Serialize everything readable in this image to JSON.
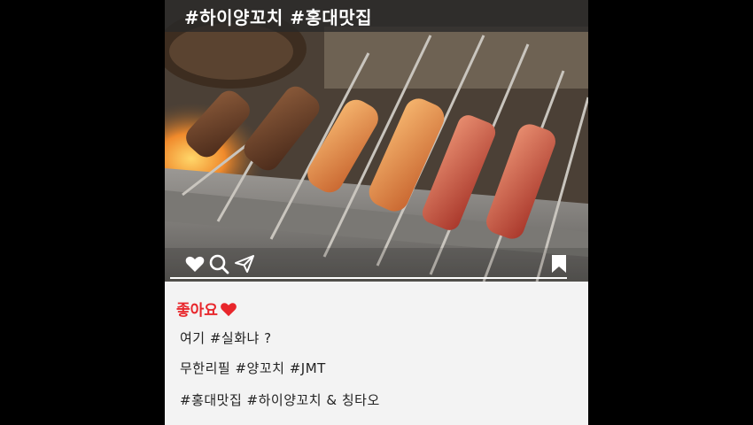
{
  "post": {
    "hashtag_title": "#하이양꼬치 #홍대맛집",
    "likes_label": "좋아요",
    "caption_lines": [
      "여기 #실화냐 ?",
      "무한리필 #양꼬치 #JMT",
      "#홍대맛집 #하이양꼬치 & 칭타오"
    ]
  },
  "icons": {
    "like": "heart-icon",
    "search": "search-icon",
    "share": "paper-plane-icon",
    "save": "bookmark-icon",
    "likes_heart": "red-heart-icon"
  },
  "colors": {
    "likes_red": "#e8262b",
    "caption_text": "#222222",
    "hashtag_bar": "#282828",
    "caption_bg": "#f3f3f3"
  }
}
